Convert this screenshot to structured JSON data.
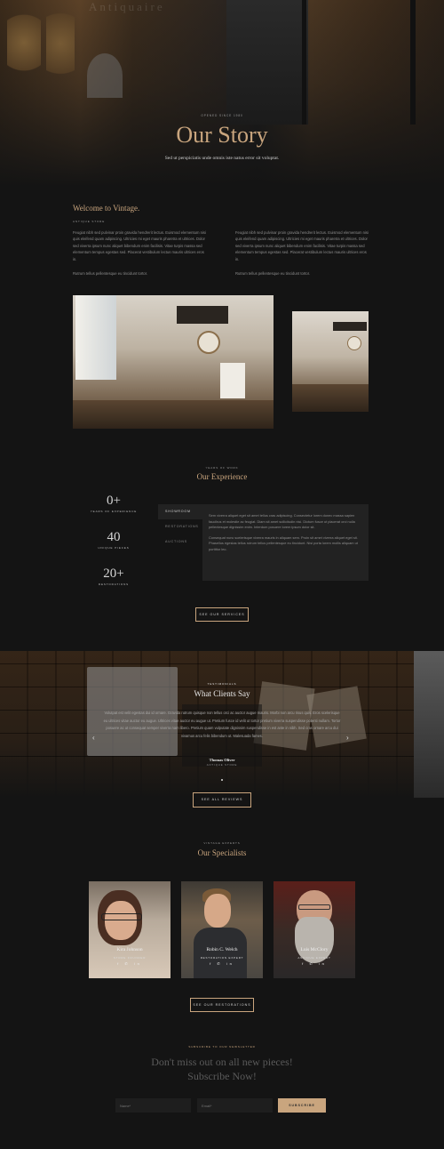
{
  "hero": {
    "sign_text": "Antiquaire",
    "eyebrow": "Opened since 1980",
    "title": "Our Story",
    "subtitle": "Sed ut perspiciatis unde omnis iste natus error sit voluptat."
  },
  "welcome": {
    "title": "Welcome to Vintage.",
    "eyebrow": "Antique Store",
    "col1_p1": "Feugiat nibh sed pulvinar proin gravida hendrerit lectus. Euismod elementum nisi quis eleifend quam adipiscing. Ultricies mi eget mauris pharetra et ultrices. Dolor sed viverra ipsum nunc aliquet bibendum enim facilisis. Vitae turpis massa sed elementum tempus egestas sed. Placerat vestibulum lectus mauris ultrices eros in.",
    "col1_p2": "Rutrum tellus pellentesque eu tincidunt tortor.",
    "col2_p1": "Feugiat nibh sed pulvinar proin gravida hendrerit lectus. Euismod elementum nisi quis eleifend quam adipiscing. Ultricies mi eget mauris pharetra et ultrices. Dolor sed viverra ipsum nunc aliquet bibendum enim facilisis. Vitae turpis massa sed elementum tempus egestas sed. Placerat vestibulum lectus mauris ultrices eros in.",
    "col2_p2": "Rutrum tellus pellentesque eu tincidunt tortor."
  },
  "experience": {
    "eyebrow": "Years of work",
    "title": "Our Experience",
    "stats": [
      {
        "value": "0+",
        "label": "Years of Experience"
      },
      {
        "value": "40",
        "label": "Unique Pieces"
      },
      {
        "value": "20+",
        "label": "Restorations"
      }
    ],
    "tabs": [
      "Showroom",
      "Restorations",
      "Auctions"
    ],
    "active_tab": "Showroom",
    "panel_p1": "Sem viverra aliquet eget sit amet tellus cras adipiscing. Consectetur lorem donec massa sapien faucibus et molestie ac feugiat. Diam sit amet sollicitudin nisi. Dictum fusce ut placerat orci nulla pellentesque dignissim enim. Interdum posuere lorem ipsum dolor sit.",
    "panel_p2": "Consequat nunc scelerisque viverra mauris in aliquam sem. Proin sit amet viverra aliquet eget sit. Phasellus egestas tellus rutrum tellus pellentesque eu tincidunt. Nisi porta lorem mollis aliquam ut porttitor leo.",
    "button": "See our services"
  },
  "testimonials": {
    "eyebrow": "Testimonials",
    "title": "What Clients Say",
    "quote": "Volutpat est velit egestas dui id ornare. Gravida rutrum quisque non tellus orci ac auctor augue mauris. Morbi non arcu risus quis. Eros scelerisque eu ultrices vitae auctor eu augue. Ultrices vitae auctor eu augue ut. Pretium fusce id velit ut tortor pretium viverra suspendisse potenti nullam. Tortor posuere ac ut consequat semper viverra nam libero. Pretium quam vulputate dignissim suspendisse in est ante in nibh. Sed cras ornare arcu dui vivamus arcu felis bibendum ut. Malesuada fames.",
    "author": "Thomas Oliver",
    "author_role": "Antique Store",
    "button": "See all reviews",
    "arrow_left": "‹",
    "arrow_right": "›"
  },
  "specialists": {
    "eyebrow": "Vintage Experts",
    "title": "Our Specialists",
    "people": [
      {
        "name": "Kira Johnson",
        "role": "Store Founder"
      },
      {
        "name": "Robin C. Welch",
        "role": "Restoration Expert"
      },
      {
        "name": "Luis McClory",
        "role": "Antique Expert"
      }
    ],
    "social": "f ✆ in",
    "button": "See our restorations"
  },
  "newsletter": {
    "eyebrow": "Subscribe to our newsletter",
    "title_line1": "Don't miss out on all new pieces!",
    "title_line2": "Subscribe Now!",
    "name_placeholder": "Name*",
    "email_placeholder": "Email*",
    "button": "Subscribe"
  },
  "colors": {
    "accent": "#c9a57e",
    "background": "#141414",
    "panel": "#222222"
  }
}
